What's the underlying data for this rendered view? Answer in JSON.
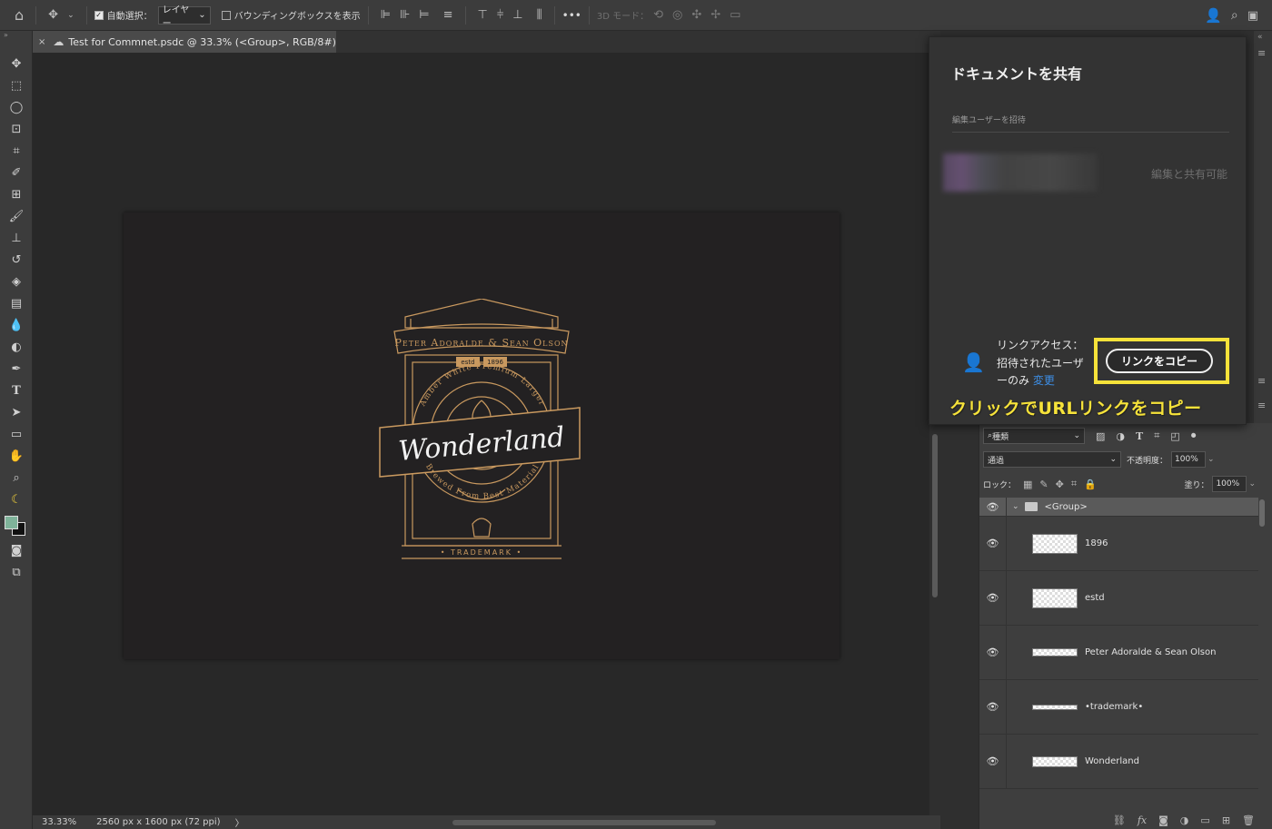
{
  "options_bar": {
    "auto_select_label": "自動選択：",
    "auto_select_value": "レイヤー",
    "bounding_box_label": "バウンディングボックスを表示",
    "mode_3d_label": "3D モード：",
    "more_label": "•••"
  },
  "document": {
    "tab_title": "Test for Commnet.psdc @ 33.3% (<Group>, RGB/8#)",
    "close_glyph": "×"
  },
  "status_bar": {
    "zoom": "33.33%",
    "dimensions": "2560 px x 1600 px (72 ppi)",
    "arrow": "〉"
  },
  "artwork": {
    "top_banner": "Peter Adoralde & Sean Olson",
    "estd": "estd",
    "year": "1896",
    "ring_top": "Amber White Premium Larger",
    "brand": "Wonderland",
    "ring_bottom": "Brewed From Best Material",
    "trademark": "• TRADEMARK •",
    "line_color": "#c9995f"
  },
  "share_popup": {
    "title": "ドキュメントを共有",
    "invite_label": "編集ユーザーを招待",
    "permission": "編集と共有可能",
    "access_line1": "リンクアクセス：",
    "access_line2": "招待されたユーザ",
    "access_line3": "ーのみ",
    "change_link": "変更",
    "copy_button": "リンクをコピー",
    "caption": "クリックでURLリンクをコピー",
    "highlight_color": "#f6e23a"
  },
  "layers_panel": {
    "kind_label": "種類",
    "blend_mode": "通過",
    "opacity_label": "不透明度：",
    "opacity_value": "100%",
    "lock_label": "ロック：",
    "fill_label": "塗り：",
    "fill_value": "100%",
    "group_name": "<Group>",
    "layers": [
      {
        "name": "1896"
      },
      {
        "name": "estd"
      },
      {
        "name": "Peter Adoralde & Sean Olson"
      },
      {
        "name": "•trademark•"
      },
      {
        "name": "Wonderland"
      }
    ]
  }
}
